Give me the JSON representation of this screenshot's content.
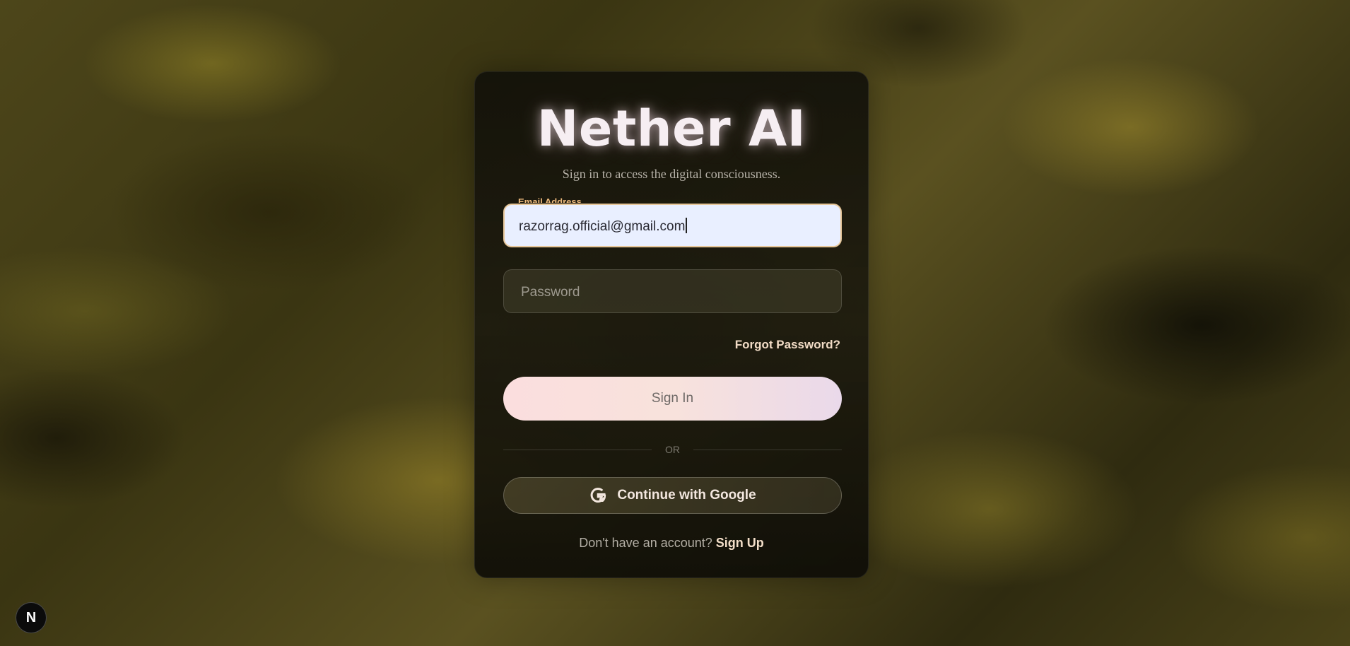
{
  "app": {
    "title": "Nether AI",
    "subtitle": "Sign in to access the digital consciousness."
  },
  "form": {
    "email": {
      "label": "Email Address",
      "value": "razorrag.official@gmail.com",
      "focused": true
    },
    "password": {
      "placeholder": "Password",
      "value": ""
    },
    "forgot_password": "Forgot Password?",
    "sign_in_label": "Sign In",
    "divider_text": "OR",
    "google_label": "Continue with Google",
    "signup_prompt": "Don't have an account?",
    "signup_link": "Sign Up"
  },
  "dev_badge": {
    "letter": "N",
    "icon": "nextjs-icon"
  },
  "colors": {
    "accent_label": "#ecb97c",
    "email_bg": "#e9efff",
    "sign_in_gradient_start": "#fbdede",
    "sign_in_gradient_end": "#ead9ea",
    "title_glow": "#f6eef2"
  }
}
